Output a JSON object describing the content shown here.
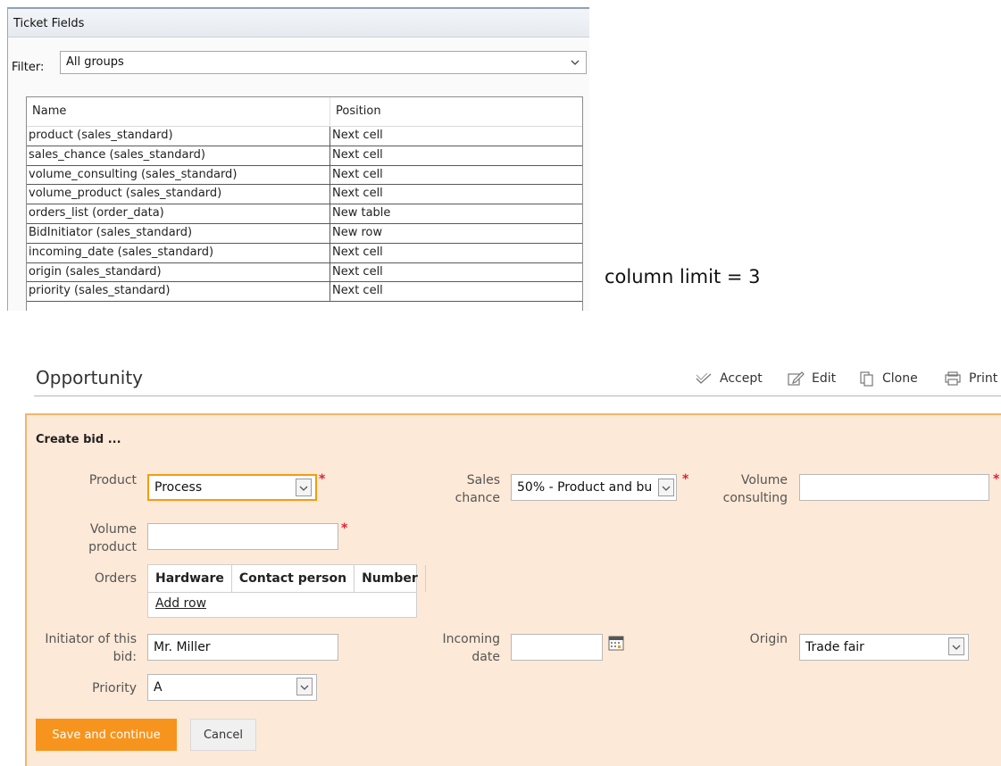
{
  "ticket_fields": {
    "title": "Ticket Fields",
    "filter_label": "Filter:",
    "filter_value": "All groups",
    "columns": {
      "name": "Name",
      "position": "Position"
    },
    "rows": [
      {
        "name": "product (sales_standard)",
        "position": "Next cell"
      },
      {
        "name": "sales_chance (sales_standard)",
        "position": "Next cell"
      },
      {
        "name": "volume_consulting (sales_standard)",
        "position": "Next cell"
      },
      {
        "name": "volume_product (sales_standard)",
        "position": "Next cell"
      },
      {
        "name": "orders_list (order_data)",
        "position": "New table"
      },
      {
        "name": "BidInitiator (sales_standard)",
        "position": "New row"
      },
      {
        "name": "incoming_date (sales_standard)",
        "position": "Next cell"
      },
      {
        "name": "origin (sales_standard)",
        "position": "Next cell"
      },
      {
        "name": "priority (sales_standard)",
        "position": "Next cell"
      }
    ]
  },
  "annotation": "column limit = 3",
  "opportunity": {
    "title": "Opportunity",
    "toolbar": {
      "accept": "Accept",
      "edit": "Edit",
      "clone": "Clone",
      "print": "Print"
    }
  },
  "form": {
    "title": "Create bid ...",
    "product": {
      "label": "Product",
      "value": "Process"
    },
    "sales_chance": {
      "label_1": "Sales",
      "label_2": "chance",
      "value": "50% - Product and bu"
    },
    "volume_consulting": {
      "label_1": "Volume",
      "label_2": "consulting",
      "value": ""
    },
    "volume_product": {
      "label_1": "Volume",
      "label_2": "product",
      "value": ""
    },
    "orders": {
      "label": "Orders",
      "columns": [
        "Hardware",
        "Contact person",
        "Number"
      ],
      "add_row": "Add row"
    },
    "initiator": {
      "label_1": "Initiator of this",
      "label_2": "bid:",
      "value": "Mr. Miller"
    },
    "incoming_date": {
      "label_1": "Incoming",
      "label_2": "date",
      "value": ""
    },
    "origin": {
      "label": "Origin",
      "value": "Trade fair"
    },
    "priority": {
      "label": "Priority",
      "value": "A"
    },
    "required_mark": "*",
    "save_label": "Save and continue",
    "cancel_label": "Cancel"
  },
  "colors": {
    "accent": "#f7941d",
    "panel_bg": "#fde9d7",
    "panel_border": "#f2b56e",
    "required": "#e0203a"
  }
}
